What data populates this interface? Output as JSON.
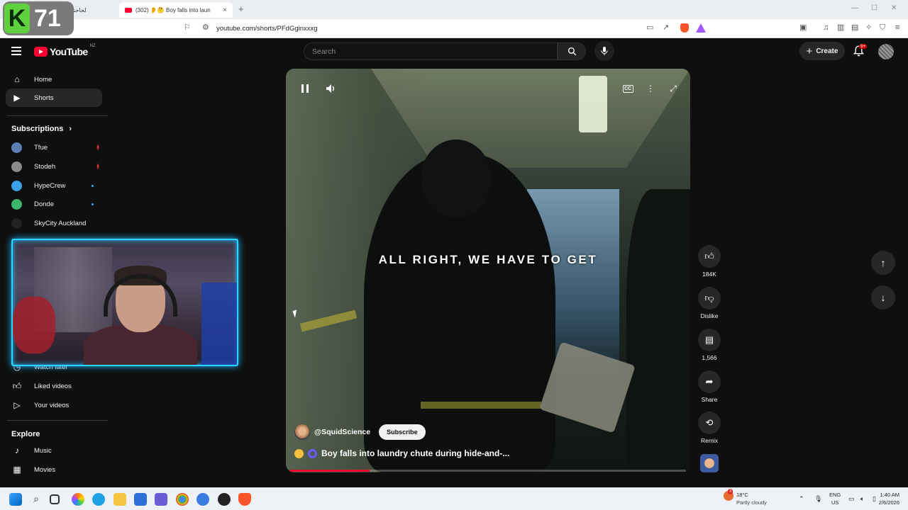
{
  "browser": {
    "tabs": [
      {
        "title": "(301) لحاحتي وأخاستي"
      },
      {
        "title": "(302) 👂🤔 Boy falls into laun",
        "close": "×"
      }
    ],
    "new_tab": "+",
    "url": "youtube.com/shorts/PFdGginxxxg"
  },
  "overlay_logo": {
    "letter": "K",
    "number": "71"
  },
  "youtube": {
    "logo_text": "YouTube",
    "country_code": "NZ",
    "search_placeholder": "Search",
    "create_label": "Create",
    "notification_count": "9+"
  },
  "sidebar": {
    "nav": [
      {
        "label": "Home",
        "icon": "home-icon"
      },
      {
        "label": "Shorts",
        "icon": "shorts-icon",
        "active": true
      }
    ],
    "subscriptions_header": "Subscriptions",
    "subscriptions": [
      {
        "name": "Tfue",
        "status": "live",
        "color": "#5b7fb5"
      },
      {
        "name": "Stodeh",
        "status": "live",
        "color": "#8a8a8a"
      },
      {
        "name": "HypeCrew",
        "status": "new",
        "color": "#3aa0e8"
      },
      {
        "name": "Donde",
        "status": "new",
        "color": "#3db56a"
      },
      {
        "name": "SkyCity Auckland",
        "status": "none",
        "color": "#222222"
      }
    ],
    "you_items": [
      {
        "label": "Watch later",
        "icon": "clock-icon"
      },
      {
        "label": "Liked videos",
        "icon": "thumbs-up-icon"
      },
      {
        "label": "Your videos",
        "icon": "play-square-icon"
      }
    ],
    "explore_header": "Explore",
    "explore_items": [
      {
        "label": "Music",
        "icon": "music-note-icon"
      },
      {
        "label": "Movies",
        "icon": "film-icon"
      }
    ]
  },
  "short": {
    "caption": "ALL RIGHT, WE HAVE TO GET",
    "channel": "@SquidScience",
    "subscribe_label": "Subscribe",
    "title": "Boy falls into laundry chute during hide-and-...",
    "progress": 0.2,
    "cc_label": "CC"
  },
  "actions": {
    "likes": "184K",
    "dislike_label": "Dislike",
    "comments": "1,566",
    "share_label": "Share",
    "remix_label": "Remix"
  },
  "taskbar": {
    "weather_temp": "18°C",
    "weather_desc": "Partly cloudy",
    "weather_badge": "3",
    "lang_top": "ENG",
    "lang_bottom": "US",
    "time": "1:40 AM",
    "date": "2/6/2026"
  }
}
